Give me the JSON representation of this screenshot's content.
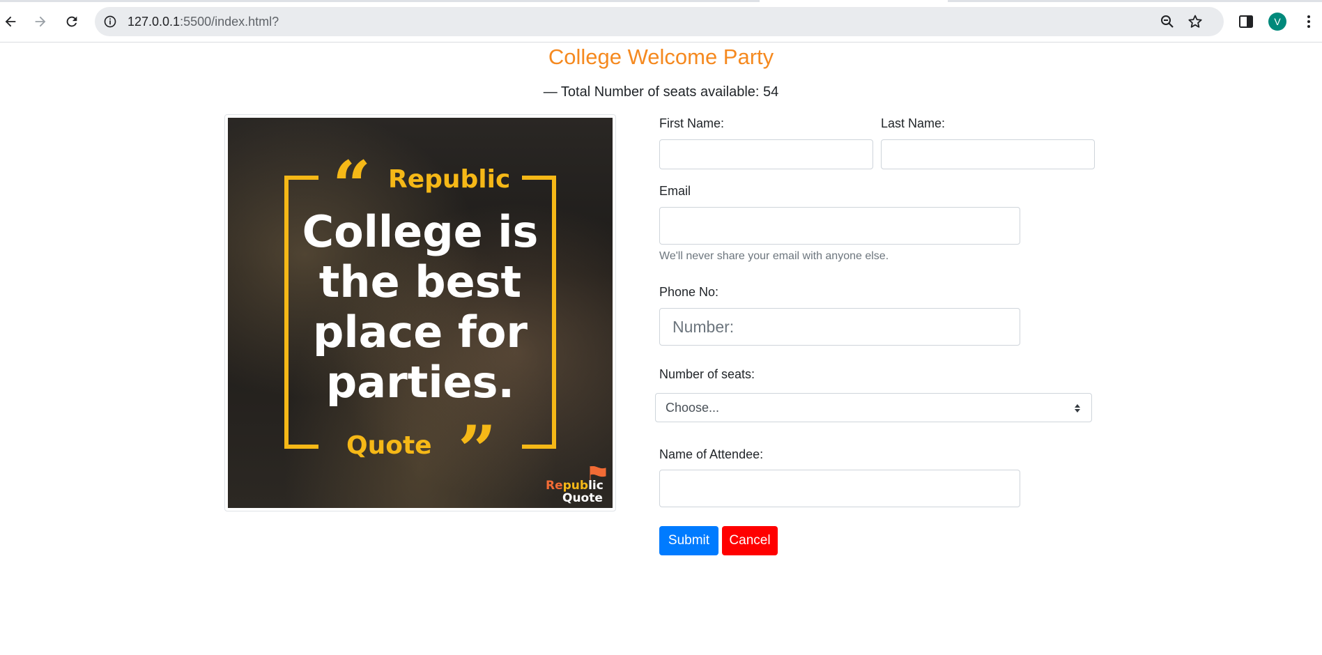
{
  "browser": {
    "url_host": "127.0.0.1",
    "url_path": ":5500/index.html?",
    "profile_initial": "V",
    "icons": [
      "back-icon",
      "forward-icon",
      "reload-icon",
      "site-info-icon",
      "zoom-icon",
      "bookmark-star-icon",
      "side-panel-icon",
      "menu-kebab-icon"
    ]
  },
  "page": {
    "title": "College Welcome Party",
    "seats_line": "— Total Number of seats available: 54"
  },
  "hero": {
    "quote_top": "Republic",
    "text_lines": [
      "College is",
      "the best",
      "place for",
      "parties."
    ],
    "quote_bottom": "Quote",
    "logo_re": "Re",
    "logo_pub": "pub",
    "logo_lic": "lic",
    "logo_quote": "Quote",
    "accent": "#f5b817"
  },
  "form": {
    "first_name_label": "First Name:",
    "last_name_label": "Last Name:",
    "email_label": "Email",
    "email_help": "We'll never share your email with anyone else.",
    "phone_label": "Phone No:",
    "phone_placeholder": "Number:",
    "seats_label": "Number of seats:",
    "seats_selected": "Choose...",
    "attendee_label": "Name of Attendee:",
    "submit_label": "Submit",
    "cancel_label": "Cancel"
  },
  "colors": {
    "title": "#f5891f",
    "primary": "#007bff",
    "danger": "#ff0000"
  }
}
